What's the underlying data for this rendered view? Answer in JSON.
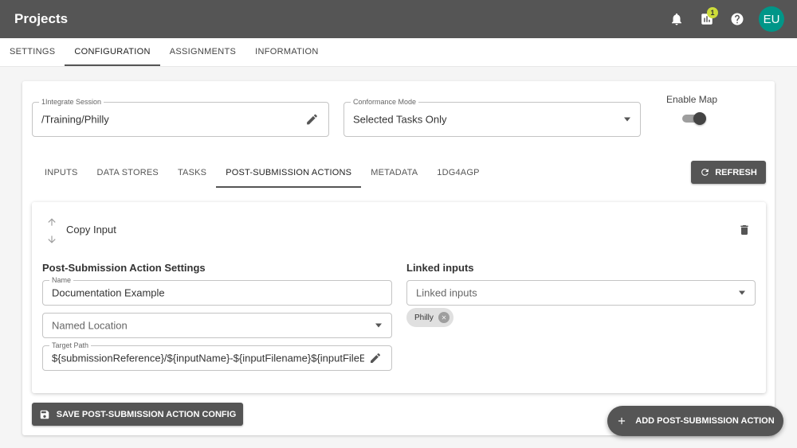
{
  "app": {
    "title": "Projects"
  },
  "header": {
    "notifications_icon": "bell-icon",
    "reports_icon": "bar-chart-icon",
    "reports_badge": "1",
    "help_icon": "help-icon",
    "user_initials": "EU",
    "avatar_color": "#009688",
    "badge_color": "#cddc39"
  },
  "main_tabs": [
    {
      "label": "SETTINGS"
    },
    {
      "label": "CONFIGURATION",
      "active": true
    },
    {
      "label": "ASSIGNMENTS"
    },
    {
      "label": "INFORMATION"
    }
  ],
  "config": {
    "session": {
      "label": "1Integrate Session",
      "value": "/Training/Philly"
    },
    "conformance": {
      "label": "Conformance Mode",
      "value": "Selected Tasks Only"
    },
    "enable_map": {
      "label": "Enable Map",
      "enabled": true
    }
  },
  "sub_tabs": [
    {
      "label": "INPUTS"
    },
    {
      "label": "DATA STORES"
    },
    {
      "label": "TASKS"
    },
    {
      "label": "POST-SUBMISSION ACTIONS",
      "active": true
    },
    {
      "label": "METADATA"
    },
    {
      "label": "1DG4AGP"
    }
  ],
  "refresh_label": "REFRESH",
  "action": {
    "title": "Copy Input",
    "settings_title": "Post-Submission Action Settings",
    "name": {
      "label": "Name",
      "value": "Documentation Example"
    },
    "named_location": {
      "placeholder": "Named Location"
    },
    "target_path": {
      "label": "Target Path",
      "value": "${submissionReference}/${inputName}-${inputFilename}${inputFileE"
    },
    "linked_title": "Linked inputs",
    "linked_select": {
      "placeholder": "Linked inputs"
    },
    "linked_chips": [
      {
        "label": "Philly"
      }
    ]
  },
  "save_label": "SAVE POST-SUBMISSION ACTION CONFIG",
  "add_label": "ADD POST-SUBMISSION ACTION",
  "colors": {
    "topbar": "#555555",
    "button": "#555555"
  }
}
